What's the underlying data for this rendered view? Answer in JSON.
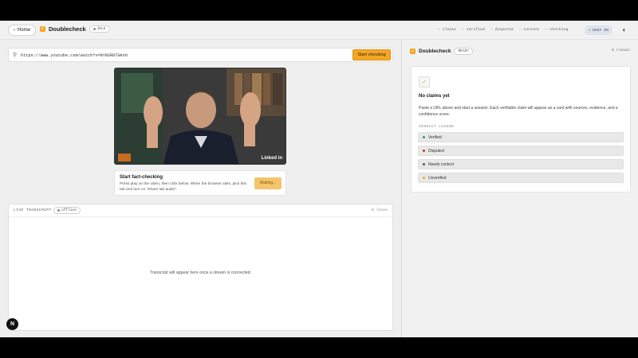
{
  "topbar": {
    "home_label": "Home",
    "brand": "Doublecheck",
    "status": "IDLE",
    "legend": [
      "claims",
      "verified",
      "disputed",
      "context",
      "checking"
    ],
    "deep_label": "DEEP ON"
  },
  "url_bar": {
    "value": "https://www.youtube.com/watch?v=NYNSR8TGKnO",
    "start_label": "Start checking"
  },
  "video": {
    "watermark": "Linked in"
  },
  "fact_check": {
    "title": "Start fact-checking",
    "description": "Press play on the video, then click below. When the browser asks, pick this tab and turn on \"Share tab audio\".",
    "button_label": "Waiting..."
  },
  "transcript": {
    "title": "LIVE TRANSCRIPT",
    "status": "offline",
    "count": "0 lines",
    "empty_text": "Transcript will appear here once a stream is connected."
  },
  "right_panel": {
    "brand": "Doublecheck",
    "status": "READY",
    "claims_count": "0 claims",
    "empty_title": "No claims yet",
    "empty_desc": "Paste a URL above and start a session. Each verifiable claim will appear as a card with sources, evidence, and a confidence score.",
    "legend_title": "VERDICT LEGEND",
    "legend": [
      {
        "label": "Verified",
        "color": "#3c9a5f"
      },
      {
        "label": "Disputed",
        "color": "#c0392b"
      },
      {
        "label": "Needs context",
        "color": "#555555"
      },
      {
        "label": "Unverified",
        "color": "#e0b030"
      }
    ]
  },
  "fab": {
    "label": "N"
  }
}
